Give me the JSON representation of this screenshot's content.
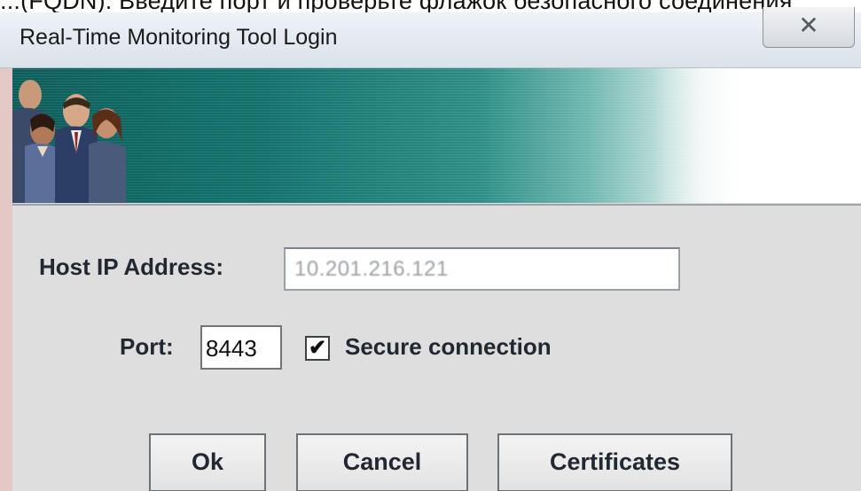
{
  "caption": {
    "text": "...(FQDN). Введите порт и проверьте флажок безопасного соединения"
  },
  "window": {
    "title": "Real-Time Monitoring Tool Login",
    "close_glyph": "✕",
    "close_icon": "close-icon"
  },
  "banner": {
    "colors": {
      "teal": "#0b5c5a",
      "fade": "#ffffff"
    }
  },
  "form": {
    "host_label": "Host IP Address:",
    "host_value": "10.201.216.121",
    "port_label": "Port:",
    "port_value": "8443",
    "secure_label": "Secure connection",
    "secure_checked": true,
    "check_glyph": "✔"
  },
  "buttons": {
    "ok_label": "Ok",
    "cancel_label": "Cancel",
    "certificates_label": "Certificates"
  }
}
